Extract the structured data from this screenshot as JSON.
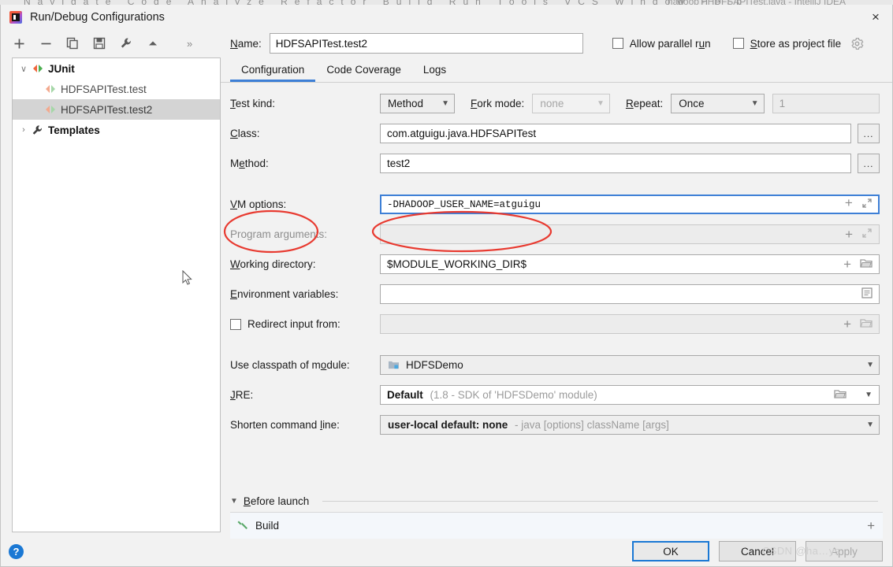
{
  "ide": {
    "menubar_items": "Navigate  Code  Analyze  Refactor  Build  Run  Tools  VCS  Window  Help",
    "window_title": "hadoop - HDFSAPITest.java - IntelliJ IDEA"
  },
  "dialog": {
    "title": "Run/Debug Configurations",
    "close_label": "×"
  },
  "left_toolbar": {
    "add": "+",
    "remove": "−",
    "copy": "copy-configuration",
    "save": "save-configuration",
    "edit_templates": "edit-templates",
    "move_up": "move-up",
    "more": "»"
  },
  "tree": {
    "items": [
      {
        "label": "JUnit",
        "level": 0,
        "icon": "junit-icon",
        "twisty": "∨",
        "bold": true,
        "selected": false
      },
      {
        "label": "HDFSAPITest.test",
        "level": 1,
        "icon": "junit-icon",
        "twisty": "",
        "bold": false,
        "selected": false
      },
      {
        "label": "HDFSAPITest.test2",
        "level": 1,
        "icon": "junit-icon",
        "twisty": "",
        "bold": false,
        "selected": true
      },
      {
        "label": "Templates",
        "level": 0,
        "icon": "wrench-icon",
        "twisty": "›",
        "bold": true,
        "selected": false
      }
    ]
  },
  "header": {
    "name_label": "Name:",
    "name_value": "HDFSAPITest.test2",
    "allow_parallel_run": "Allow parallel run",
    "allow_parallel_run_checked": false,
    "store_as_project_file": "Store as project file",
    "store_as_project_file_checked": false
  },
  "tabs": [
    {
      "label": "Configuration",
      "active": true
    },
    {
      "label": "Code Coverage",
      "active": false
    },
    {
      "label": "Logs",
      "active": false
    }
  ],
  "form": {
    "test_kind_label": "Test kind:",
    "test_kind_value": "Method",
    "fork_mode_label": "Fork mode:",
    "fork_mode_value": "none",
    "repeat_label": "Repeat:",
    "repeat_value": "Once",
    "repeat_count_value": "1",
    "class_label": "Class:",
    "class_value": "com.atguigu.java.HDFSAPITest",
    "class_browse": "...",
    "method_label": "Method:",
    "method_value": "test2",
    "method_browse": "...",
    "vm_options_label": "VM options:",
    "vm_options_value": "-DHADOOP_USER_NAME=atguigu",
    "program_arguments_label": "Program arguments:",
    "program_arguments_value": "",
    "working_directory_label": "Working directory:",
    "working_directory_value": "$MODULE_WORKING_DIR$",
    "environment_variables_label": "Environment variables:",
    "environment_variables_value": "",
    "redirect_input_label": "Redirect input from:",
    "redirect_input_checked": false,
    "redirect_input_value": "",
    "use_classpath_label": "Use classpath of module:",
    "use_classpath_value": "HDFSDemo",
    "jre_label": "JRE:",
    "jre_value": "Default",
    "jre_value_hint": "(1.8 - SDK of 'HDFSDemo' module)",
    "shorten_label": "Shorten command line:",
    "shorten_value": "user-local default: none",
    "shorten_value_hint": "- java [options] className [args]",
    "expand_icon": "expand-icon",
    "plus_icon": "+",
    "folder_icon": "folder-icon"
  },
  "before_launch": {
    "header": "Before launch",
    "items": [
      {
        "label": "Build",
        "icon": "build-hammer-icon"
      }
    ],
    "add_label": "+"
  },
  "footer": {
    "help": "?",
    "ok": "OK",
    "cancel": "Cancel",
    "apply": "Apply"
  },
  "watermark": {
    "text": "CSDN @ha…ys"
  },
  "annotations": {
    "ellipse_label_target": "VM options:",
    "ellipse_value_target": "-DHADOOP_USER_NAME=atguigu",
    "color": "#e83a30"
  }
}
